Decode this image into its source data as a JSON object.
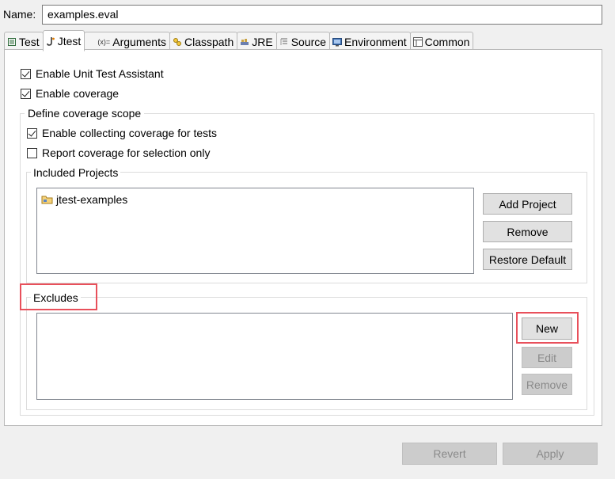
{
  "name_label": "Name:",
  "name_value": "examples.eval",
  "tabs": [
    {
      "label": "Test",
      "icon": "test-icon"
    },
    {
      "label": "Jtest",
      "icon": "jtest-icon"
    },
    {
      "label": "Arguments",
      "icon": "arguments-icon"
    },
    {
      "label": "Classpath",
      "icon": "classpath-icon"
    },
    {
      "label": "JRE",
      "icon": "jre-icon"
    },
    {
      "label": "Source",
      "icon": "source-icon"
    },
    {
      "label": "Environment",
      "icon": "environment-icon"
    },
    {
      "label": "Common",
      "icon": "common-icon"
    }
  ],
  "active_tab": "Jtest",
  "options": {
    "enable_uta": {
      "label": "Enable Unit Test Assistant",
      "checked": true
    },
    "enable_coverage": {
      "label": "Enable coverage",
      "checked": true
    }
  },
  "coverage_scope": {
    "title": "Define coverage scope",
    "collect_for_tests": {
      "label": "Enable collecting coverage for tests",
      "checked": true
    },
    "selection_only": {
      "label": "Report coverage for selection only",
      "checked": false
    },
    "included_projects": {
      "title": "Included Projects",
      "items": [
        {
          "label": "jtest-examples",
          "icon": "project-folder-icon"
        }
      ],
      "add_button": "Add Project",
      "remove_button": "Remove",
      "restore_button": "Restore Default"
    },
    "excludes": {
      "title": "Excludes",
      "items": [],
      "new_button": "New",
      "edit_button": "Edit",
      "remove_button": "Remove"
    }
  },
  "footer": {
    "revert_button": "Revert",
    "apply_button": "Apply"
  },
  "colors": {
    "highlight": "#e8505b",
    "panel_bg": "#ffffff",
    "window_bg": "#f0f0f0"
  }
}
